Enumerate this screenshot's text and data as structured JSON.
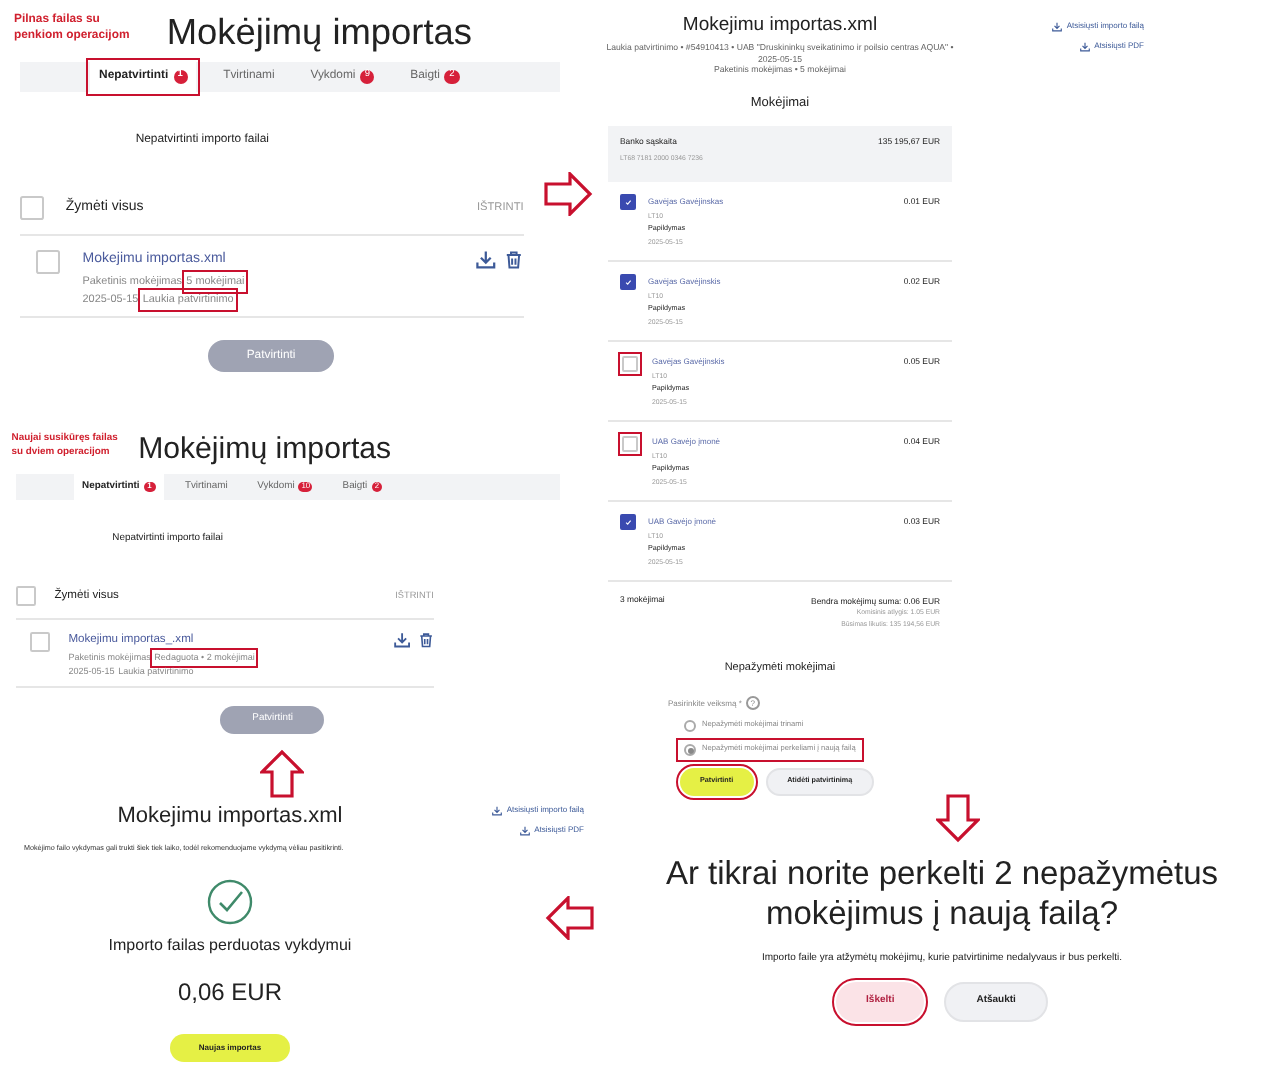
{
  "screens": [
    {
      "annotation": "Pilnas failas su penkiom operacijom",
      "title": "Mokėjimų importas",
      "tabs": [
        {
          "label": "Nepatvirtinti",
          "count": "1",
          "selected": true,
          "highlighted": true
        },
        {
          "label": "Tvirtinami",
          "selected": false,
          "highlighted": false
        },
        {
          "label": "Vykdomi",
          "count": "9",
          "selected": false,
          "highlighted": false
        },
        {
          "label": "Baigti",
          "count": "2",
          "selected": false,
          "highlighted": false
        }
      ],
      "section_title": "Nepatvirtinti importo failai",
      "select_all": "Žymėti visus",
      "select_all_checked": false,
      "delete": "IŠTRINTI",
      "files": [
        {
          "name": "Mokejimu importas.xml",
          "type": "Paketinis mokėjimas",
          "count": "5 mokėjimai",
          "count_highlighted": true,
          "date": "2025-05-15",
          "status": "Laukia patvirtinimo",
          "status_highlighted": true,
          "checked": false
        }
      ],
      "confirm_button": "Patvirtinti"
    },
    {
      "annotation": "Naujai susikūręs failas su dviem operacijom",
      "title": "Mokėjimų importas",
      "tabs": [
        {
          "label": "Nepatvirtinti",
          "count": "1",
          "selected": true,
          "highlighted": false
        },
        {
          "label": "Tvirtinami",
          "selected": false,
          "highlighted": false
        },
        {
          "label": "Vykdomi",
          "count": "10",
          "selected": false,
          "highlighted": false
        },
        {
          "label": "Baigti",
          "count": "2",
          "selected": false,
          "highlighted": false
        }
      ],
      "section_title": "Nepatvirtinti importo failai",
      "select_all": "Žymėti visus",
      "select_all_checked": false,
      "delete": "IŠTRINTI",
      "files": [
        {
          "name": "Mokejimu importas_.xml",
          "type": "Paketinis mokėjimas",
          "count": "Redaguota • 2 mokėjimai",
          "count_highlighted": true,
          "date": "2025-05-15",
          "status": "Laukia patvirtinimo",
          "status_highlighted": false,
          "checked": false
        }
      ],
      "confirm_button": "Patvirtinti"
    }
  ],
  "result": {
    "title": "Mokejimu importas.xml",
    "links": [
      "Atsisiųsti importo failą",
      "Atsisiųsti PDF"
    ],
    "note": "Mokėjimo failo vykdymas gali trukti šiek tiek laiko, todėl rekomenduojame vykdymą vėliau pasitikrinti.",
    "message": "Importo failas perduotas vykdymui",
    "amount": "0,06 EUR",
    "button": "Naujas importas"
  },
  "details": {
    "title": "Mokejimu importas.xml",
    "links": [
      "Atsisiųsti importo failą",
      "Atsisiųsti PDF"
    ],
    "meta": [
      "Laukia patvirtinimo • #54910413 • UAB \"Druskininkų sveikatinimo ir poilsio centras AQUA\" • 2025-05-15",
      "Paketinis mokėjimas • 5 mokėjimai"
    ],
    "payments_title": "Mokėjimai",
    "account": {
      "label": "Banko sąskaita",
      "iban": "LT68 7181 2000 0346 7236",
      "balance": "135 195,67 EUR"
    },
    "payments": [
      {
        "name": "Gavėjas Gavėjinskas",
        "iban": "LT10",
        "purpose": "Papildymas",
        "date": "2025-05-15",
        "amount": "0.01 EUR",
        "checked": true,
        "highlighted": false
      },
      {
        "name": "Gavėjas Gavėjinskis",
        "iban": "LT10",
        "purpose": "Papildymas",
        "date": "2025-05-15",
        "amount": "0.02 EUR",
        "checked": true,
        "highlighted": false
      },
      {
        "name": "Gavėjas Gavėjinskis",
        "iban": "LT10",
        "purpose": "Papildymas",
        "date": "2025-05-15",
        "amount": "0.05 EUR",
        "checked": false,
        "highlighted": true
      },
      {
        "name": "UAB Gavėjo įmonė",
        "iban": "LT10",
        "purpose": "Papildymas",
        "date": "2025-05-15",
        "amount": "0.04 EUR",
        "checked": false,
        "highlighted": true
      },
      {
        "name": "UAB Gavėjo įmonė",
        "iban": "LT10",
        "purpose": "Papildymas",
        "date": "2025-05-15",
        "amount": "0.03 EUR",
        "checked": true,
        "highlighted": false
      }
    ],
    "summary": {
      "count": "3 mokėjimai",
      "total": "Bendra mokėjimų suma: 0.06 EUR",
      "commission": "Komisinis atlygis: 1.05 EUR",
      "future_balance": "Būsimas likutis: 135 194,56 EUR"
    },
    "unmarked_title": "Nepažymėti mokėjimai",
    "action_label": "Pasirinkite veiksmą *",
    "help": "?",
    "options": [
      {
        "label": "Nepažymėti mokėjimai trinami",
        "selected": false,
        "highlighted": false
      },
      {
        "label": "Nepažymėti mokėjimai perkeliami į naują failą",
        "selected": true,
        "highlighted": true
      }
    ],
    "buttons": [
      {
        "label": "Patvirtinti",
        "kind": "primary",
        "highlighted": true
      },
      {
        "label": "Atidėti patvirtinimą",
        "kind": "secondary",
        "highlighted": false
      }
    ]
  },
  "dialog": {
    "heading": "Ar tikrai norite perkelti 2 nepažymėtus mokėjimus į naują failą?",
    "text": "Importo faile yra atžymėtų mokėjimų, kurie patvirtinime nedalyvaus ir bus perkelti.",
    "buttons": [
      {
        "label": "Iškelti",
        "kind": "danger",
        "highlighted": true
      },
      {
        "label": "Atšaukti",
        "kind": "secondary",
        "highlighted": false
      }
    ]
  }
}
